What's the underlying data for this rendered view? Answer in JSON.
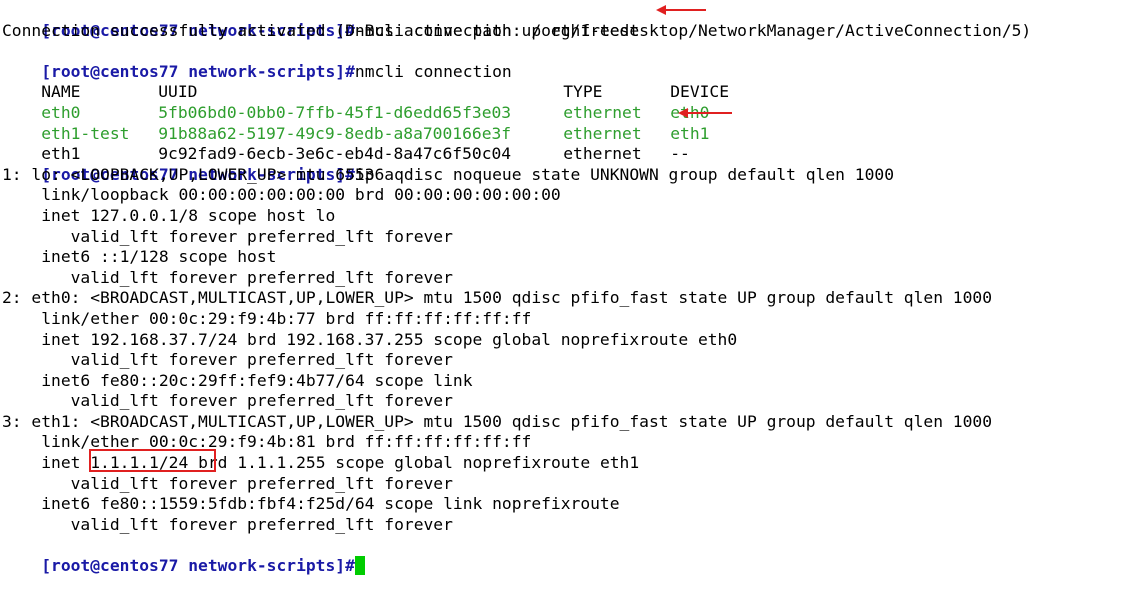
{
  "prompt": "[root@centos77 network-scripts]#",
  "commands": {
    "up": "nmcli connection up eth1-test",
    "show": "nmcli connection",
    "ip": "ip a"
  },
  "output": {
    "activated": "Connection successfully activated (D-Bus active path: /org/freedesktop/NetworkManager/ActiveConnection/5)"
  },
  "connections": {
    "headers": [
      "NAME",
      "UUID",
      "TYPE",
      "DEVICE"
    ],
    "rows": [
      {
        "name": "eth0",
        "uuid": "5fb06bd0-0bb0-7ffb-45f1-d6edd65f3e03",
        "type": "ethernet",
        "device": "eth0",
        "active": true
      },
      {
        "name": "eth1-test",
        "uuid": "91b88a62-5197-49c9-8edb-a8a700166e3f",
        "type": "ethernet",
        "device": "eth1",
        "active": true
      },
      {
        "name": "eth1",
        "uuid": "9c92fad9-6ecb-3e6c-eb4d-8a47c6f50c04",
        "type": "ethernet",
        "device": "--",
        "active": false
      }
    ]
  },
  "ip_output": [
    "1: lo: <LOOPBACK,UP,LOWER_UP> mtu 65536 qdisc noqueue state UNKNOWN group default qlen 1000",
    "    link/loopback 00:00:00:00:00:00 brd 00:00:00:00:00:00",
    "    inet 127.0.0.1/8 scope host lo",
    "       valid_lft forever preferred_lft forever",
    "    inet6 ::1/128 scope host",
    "       valid_lft forever preferred_lft forever",
    "2: eth0: <BROADCAST,MULTICAST,UP,LOWER_UP> mtu 1500 qdisc pfifo_fast state UP group default qlen 1000",
    "    link/ether 00:0c:29:f9:4b:77 brd ff:ff:ff:ff:ff:ff",
    "    inet 192.168.37.7/24 brd 192.168.37.255 scope global noprefixroute eth0",
    "       valid_lft forever preferred_lft forever",
    "    inet6 fe80::20c:29ff:fef9:4b77/64 scope link",
    "       valid_lft forever preferred_lft forever",
    "3: eth1: <BROADCAST,MULTICAST,UP,LOWER_UP> mtu 1500 qdisc pfifo_fast state UP group default qlen 1000",
    "    link/ether 00:0c:29:f9:4b:81 brd ff:ff:ff:ff:ff:ff"
  ],
  "eth1_inet": {
    "prefix": "    inet ",
    "address": "1.1.1.1/24",
    "suffix": " brd 1.1.1.255 scope global noprefixroute eth1"
  },
  "ip_output_tail": [
    "       valid_lft forever preferred_lft forever",
    "    inet6 fe80::1559:5fdb:fbf4:f25d/64 scope link noprefixroute",
    "       valid_lft forever preferred_lft forever"
  ],
  "colors": {
    "prompt": "#1a1aa6",
    "active_connection": "#2e9e2e",
    "annotation": "#e02020",
    "cursor": "#00cc00"
  }
}
